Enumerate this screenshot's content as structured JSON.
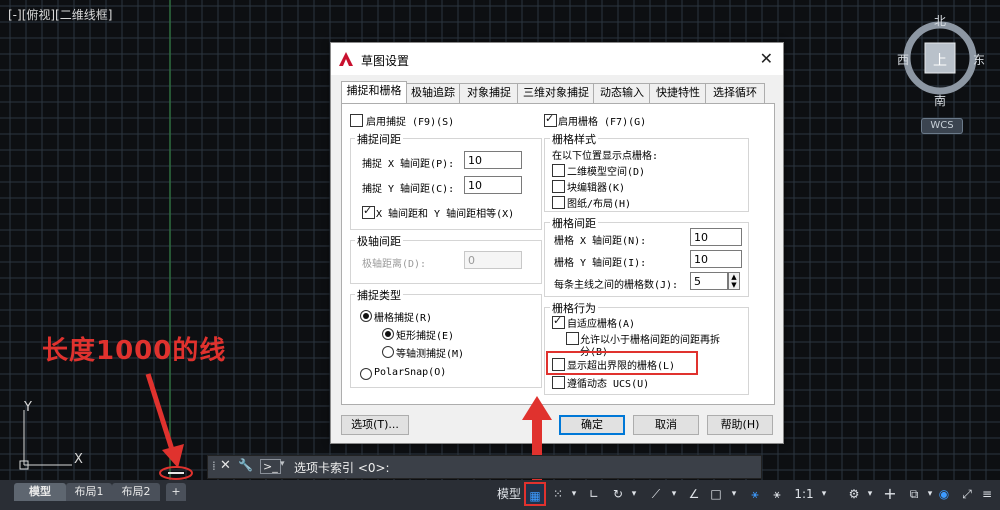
{
  "viewport": {
    "label": "[-][俯视][二维线框]"
  },
  "navcube": {
    "north": "北",
    "south": "南",
    "east": "东",
    "west": "西",
    "face": "上",
    "wcs": "WCS"
  },
  "annotation": {
    "text": "长度1000的线"
  },
  "ucs": {
    "y": "Y",
    "x": "X"
  },
  "dialog": {
    "title": "草图设置",
    "tabs": [
      "捕捉和栅格",
      "极轴追踪",
      "对象捕捉",
      "三维对象捕捉",
      "动态输入",
      "快捷特性",
      "选择循环"
    ],
    "active_tab": 0,
    "snap_on": {
      "label": "启用捕捉 (F9)(S)",
      "checked": false
    },
    "snap_spacing": {
      "title": "捕捉间距",
      "x_label": "捕捉 X 轴间距(P):",
      "x_value": "10",
      "y_label": "捕捉 Y 轴间距(C):",
      "y_value": "10",
      "equal_label": "X 轴间距和 Y 轴间距相等(X)",
      "equal_checked": true
    },
    "polar_spacing": {
      "title": "极轴间距",
      "label": "极轴距离(D):",
      "value": "0"
    },
    "snap_type": {
      "title": "捕捉类型",
      "grid_snap": "栅格捕捉(R)",
      "rect_snap": "矩形捕捉(E)",
      "iso_snap": "等轴测捕捉(M)",
      "polar_snap": "PolarSnap(O)"
    },
    "grid_on": {
      "label": "启用栅格 (F7)(G)",
      "checked": true
    },
    "grid_style": {
      "title": "栅格样式",
      "desc": "在以下位置显示点栅格:",
      "model": "二维模型空间(D)",
      "block": "块编辑器(K)",
      "paper": "图纸/布局(H)"
    },
    "grid_spacing": {
      "title": "栅格间距",
      "x_label": "栅格 X 轴间距(N):",
      "x_value": "10",
      "y_label": "栅格 Y 轴间距(I):",
      "y_value": "10",
      "major_label": "每条主线之间的栅格数(J):",
      "major_value": "5"
    },
    "grid_behavior": {
      "title": "栅格行为",
      "adaptive": "自适应栅格(A)",
      "subdiv_line1": "允许以小于栅格间距的间距再拆",
      "subdiv_line2": "分(B)",
      "beyond": "显示超出界限的栅格(L)",
      "follow": "遵循动态 UCS(U)"
    },
    "buttons": {
      "options": "选项(T)...",
      "ok": "确定",
      "cancel": "取消",
      "help": "帮助(H)"
    }
  },
  "cmdline": {
    "prompt": "选项卡索引 <0>:"
  },
  "layout_tabs": [
    "模型",
    "布局1",
    "布局2",
    "+"
  ],
  "status": {
    "model": "模型",
    "scale": "1:1"
  },
  "colors": {
    "accent": "#0078d7",
    "highlight": "#e0322e",
    "grid_line": "#2c3540"
  }
}
